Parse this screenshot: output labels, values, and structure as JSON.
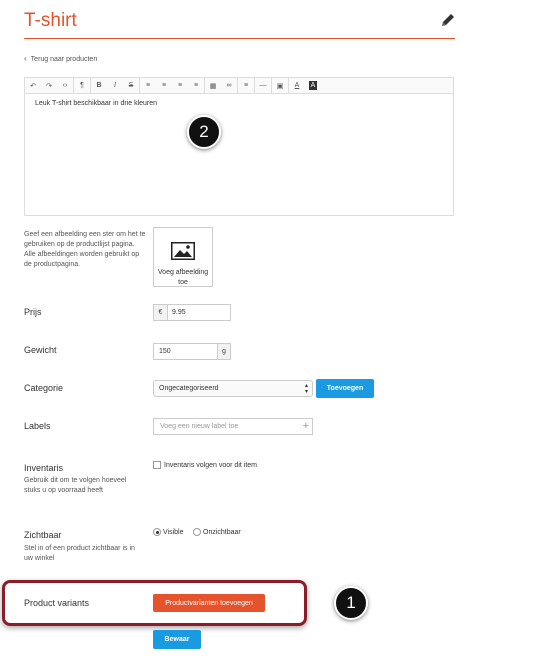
{
  "header": {
    "title": "T-shirt",
    "edit_icon": "pencil-icon"
  },
  "nav": {
    "back_label": "Terug naar producten"
  },
  "editor": {
    "toolbar_icons": [
      "undo-icon",
      "redo-icon",
      "code-icon",
      "paragraph-icon",
      "bold-icon",
      "italic-icon",
      "strikethrough-icon",
      "bullet-list-icon",
      "numbered-list-icon",
      "outdent-icon",
      "indent-icon",
      "table-icon",
      "link-icon",
      "align-icon",
      "horizontal-rule-icon",
      "image-icon",
      "font-color-icon",
      "background-color-icon"
    ],
    "toolbar_glyphs": [
      "↶",
      "↷",
      "‹›",
      "¶",
      "B",
      "I",
      "S",
      "≡",
      "≡",
      "≡",
      "≡",
      "▦",
      "∞",
      "≡",
      "—",
      "▣",
      "A",
      "A"
    ],
    "content": "Leuk T-shirt beschikbaar in drie kleuren"
  },
  "callouts": {
    "one": "1",
    "two": "2"
  },
  "image": {
    "help": "Geef een afbeelding een ster om het te gebruiken op de productlijst pagina. Alle afbeeldingen worden gebruikt op de productpagina.",
    "add_label": "Voeg afbeelding toe"
  },
  "price": {
    "label": "Prijs",
    "currency": "€",
    "value": "9.95"
  },
  "weight": {
    "label": "Gewicht",
    "value": "150",
    "unit": "g"
  },
  "category": {
    "label": "Categorie",
    "selected": "Ongecategoriseerd",
    "add_button": "Toevoegen"
  },
  "labels": {
    "label": "Labels",
    "placeholder": "Voeg een nieuw label toe"
  },
  "inventory": {
    "label": "Inventaris",
    "help": "Gebruik dit om te volgen hoeveel stuks u op voorraad heeft",
    "checkbox_label": "Inventaris volgen voor dit item"
  },
  "visibility": {
    "label": "Zichtbaar",
    "help": "Stel in of een product zichtbaar is in uw winkel",
    "options": [
      "Visible",
      "Onzichtbaar"
    ],
    "selected": "Visible"
  },
  "variants": {
    "label": "Product variants",
    "button": "Productvarianten toevoegen"
  },
  "save": {
    "label": "Bewaar"
  },
  "colors": {
    "accent": "#e4532b",
    "primary": "#1a9ae0",
    "highlight": "#8b1c2a"
  }
}
